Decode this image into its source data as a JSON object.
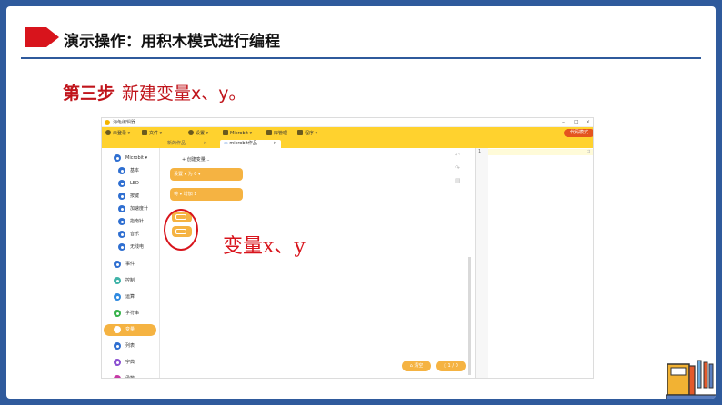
{
  "slide": {
    "title": "演示操作：用积木模式进行编程",
    "step_label": "第三步",
    "step_text": "新建变量x、y。",
    "annotation": "变量x、y"
  },
  "app": {
    "title": "海龟编辑器",
    "window_controls": [
      "–",
      "□",
      "×"
    ],
    "toolbar": [
      {
        "icon": "user-icon",
        "label": "未登录 ▾"
      },
      {
        "icon": "folder-icon",
        "label": "文件 ▾"
      },
      {
        "icon": "gear-icon",
        "label": "设置 ▾"
      },
      {
        "icon": "robot-icon",
        "label": "Microbit ▾"
      },
      {
        "icon": "library-icon",
        "label": "库管理"
      },
      {
        "icon": "terminal-icon",
        "label": "程序 ▾"
      }
    ],
    "code_mode_button": "代码模式",
    "tabs": [
      {
        "label": "新的作品",
        "active": false
      },
      {
        "label": "microbit作品",
        "active": true
      }
    ],
    "categories": [
      {
        "label": "Microbit ▾",
        "color": "#2f6fd1"
      },
      {
        "label": "基本",
        "color": "#2f6fd1"
      },
      {
        "label": "LED",
        "color": "#2f6fd1"
      },
      {
        "label": "按键",
        "color": "#2f6fd1"
      },
      {
        "label": "加速度计",
        "color": "#2f6fd1"
      },
      {
        "label": "指南针",
        "color": "#2f6fd1"
      },
      {
        "label": "音乐",
        "color": "#2f6fd1"
      },
      {
        "label": "无线电",
        "color": "#2f6fd1"
      },
      {
        "label": "事件",
        "color": "#2f6fd1"
      },
      {
        "label": "控制",
        "color": "#3fb3a8"
      },
      {
        "label": "运算",
        "color": "#2f8ae0"
      },
      {
        "label": "字符串",
        "color": "#36b24a"
      },
      {
        "label": "变量",
        "color": "#f5b342"
      },
      {
        "label": "列表",
        "color": "#2f6fd1"
      },
      {
        "label": "字典",
        "color": "#8a4fd1"
      },
      {
        "label": "函数",
        "color": "#c63aa6"
      }
    ],
    "flyout": {
      "create_variable": "+ 创建变量...",
      "blocks": [
        {
          "text": "设置  ▾  为  0  ▾"
        },
        {
          "text": "将  ▾  增加  1"
        }
      ]
    },
    "bottom_buttons": [
      "清空",
      "1 / 0"
    ],
    "code_panel": {
      "line_number": "1"
    }
  },
  "colors": {
    "accent_red": "#c0141b",
    "toolbar_yellow": "#ffd22e",
    "block_orange": "#f5b342",
    "slide_border": "#2f5a9c"
  }
}
